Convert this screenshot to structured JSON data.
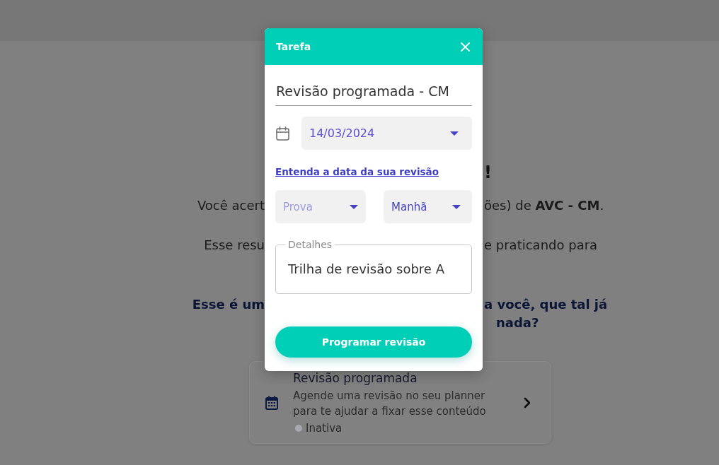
{
  "page": {
    "heading_tail": "!",
    "summary_lines": [
      {
        "left": "Você acert",
        "right": "ões) de **AVC - CM**."
      },
      {
        "left": "Esse resu",
        "right": "e praticando para"
      }
    ],
    "prompt_lines": [
      {
        "left": "Esse é um",
        "right": "a você, que tal já"
      },
      {
        "right": "nada?"
      }
    ],
    "card": {
      "title": "Revisão programada",
      "description": "Agende uma revisão no seu planner para te ajudar a fixar esse conteúdo",
      "status": "Inativa",
      "active": false
    }
  },
  "dialog": {
    "title": "Tarefa",
    "task_title": "Revisão programada - CM",
    "date": "14/03/2024",
    "help_link": "Entenda a data da sua revisão",
    "selects": [
      {
        "placeholder": "Prova"
      },
      {
        "value": "Manhã"
      }
    ],
    "details": {
      "label": "Detalhes",
      "value": "Trilha de revisão sobre A"
    },
    "submit": "Programar revisão"
  }
}
